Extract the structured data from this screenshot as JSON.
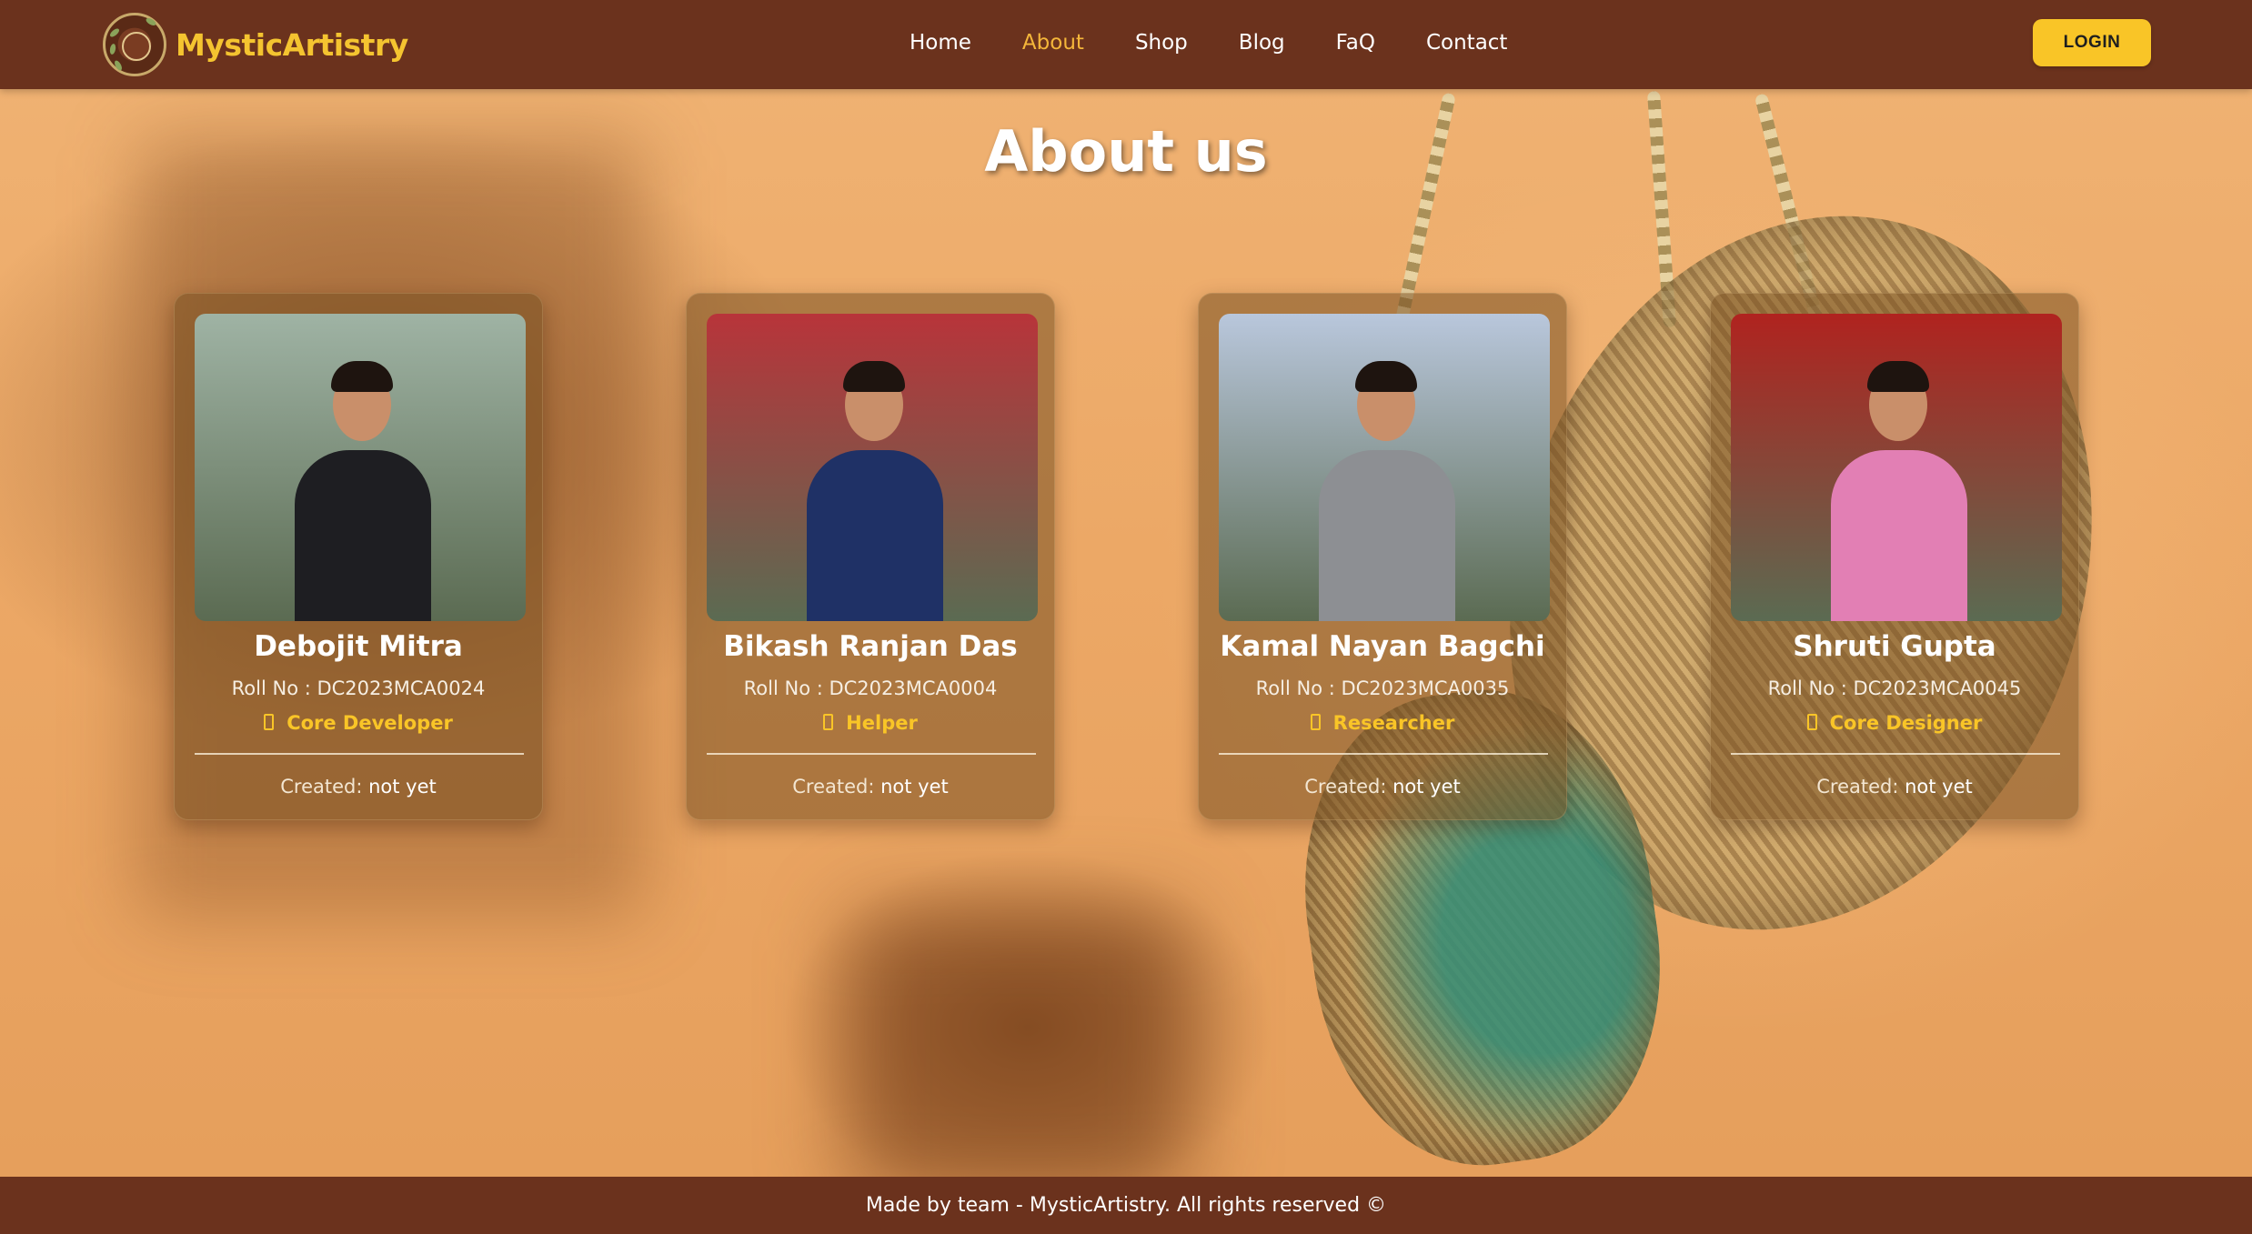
{
  "site": {
    "brand": "MysticArtistry"
  },
  "nav": {
    "items": [
      "Home",
      "About",
      "Shop",
      "Blog",
      "FaQ",
      "Contact"
    ],
    "active": "About"
  },
  "header": {
    "login_label": "LOGIN"
  },
  "page": {
    "title": "About us"
  },
  "team": [
    {
      "name": "Debojit Mitra",
      "roll": "Roll No : DC2023MCA0024",
      "role": "Core Developer",
      "created_label": "Created:",
      "created_value": "not yet",
      "photo_colors": [
        "#9fb3a4",
        "#1e1e22"
      ]
    },
    {
      "name": "Bikash Ranjan Das",
      "roll": "Roll No : DC2023MCA0004",
      "role": "Helper",
      "created_label": "Created:",
      "created_value": "not yet",
      "photo_colors": [
        "#b8343a",
        "#1f3166"
      ]
    },
    {
      "name": "Kamal Nayan Bagchi",
      "roll": "Roll No : DC2023MCA0035",
      "role": "Researcher",
      "created_label": "Created:",
      "created_value": "not yet",
      "photo_colors": [
        "#b9c7dc",
        "#8d8f93"
      ]
    },
    {
      "name": "Shruti Gupta",
      "roll": "Roll No : DC2023MCA0045",
      "role": "Core Designer",
      "created_label": "Created:",
      "created_value": "not yet",
      "photo_colors": [
        "#b0231f",
        "#e27fb4"
      ]
    }
  ],
  "footer": {
    "text": "Made by team - MysticArtistry. All rights reserved ©"
  },
  "colors": {
    "header_bg": "#6b321d",
    "accent": "#f9c527",
    "active_nav": "#f4b63a"
  }
}
